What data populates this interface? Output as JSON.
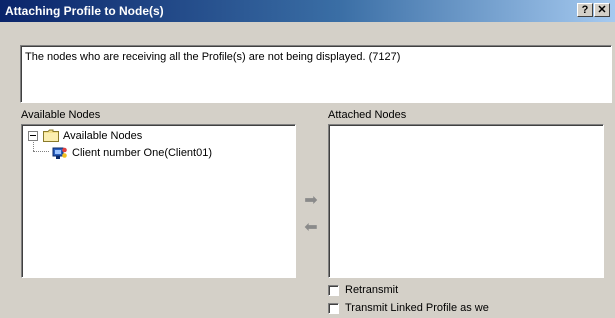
{
  "window": {
    "title": "Attaching Profile to Node(s)",
    "help_label": "?",
    "close_label": "✕"
  },
  "message": "The nodes who are receiving all the Profile(s) are not being displayed. (7127)",
  "available": {
    "label": "Available Nodes",
    "tree": {
      "root_label": "Available Nodes",
      "children": [
        "Client number One(Client01)"
      ]
    }
  },
  "attached": {
    "label": "Attached Nodes"
  },
  "arrows": {
    "add": "➡",
    "remove": "⬅"
  },
  "options": {
    "retransmit_label": "Retransmit",
    "transmit_linked_label": "Transmit Linked Profile as we"
  },
  "icons": {
    "folder": "folder-icon",
    "client": "client-node-icon"
  },
  "colors": {
    "title_start": "#0a246a",
    "title_end": "#a6caf0",
    "dialog_bg": "#d4d0c8"
  }
}
